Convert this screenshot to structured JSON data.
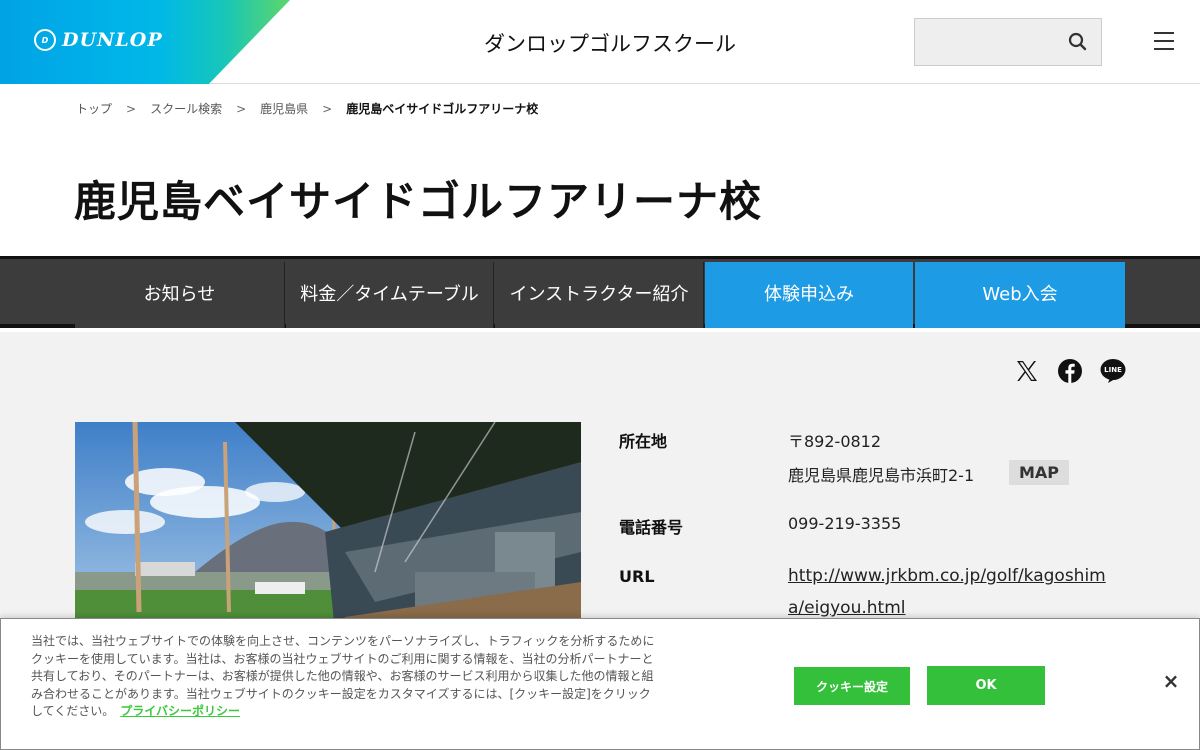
{
  "header": {
    "logo_text": "DUNLOP",
    "logo_mark": "D",
    "site_title": "ダンロップゴルフスクール",
    "search_placeholder": "",
    "search_icon": "search-icon",
    "menu_icon": "hamburger-menu-icon"
  },
  "breadcrumb": {
    "items": [
      "トップ",
      "スクール検索",
      "鹿児島県",
      "鹿児島ベイサイドゴルフアリーナ校"
    ],
    "separator": ">"
  },
  "page_title": "鹿児島ベイサイドゴルフアリーナ校",
  "nav": {
    "items": [
      {
        "label": "お知らせ"
      },
      {
        "label": "料金／タイムテーブル"
      },
      {
        "label": "インストラクター紹介"
      },
      {
        "label": "体験申込み"
      },
      {
        "label": "Web入会"
      }
    ],
    "accent_color": "#1d9be4"
  },
  "share": {
    "x_icon": "x-twitter-icon",
    "facebook_icon": "facebook-icon",
    "line_icon": "line-icon",
    "line_text": "LINE"
  },
  "info": {
    "address_label": "所在地",
    "postal": "〒892-0812",
    "address": "鹿児島県鹿児島市浜町2-1",
    "map_label": "MAP",
    "phone_label": "電話番号",
    "phone": "099-219-3355",
    "url_label": "URL",
    "url": "http://www.jrkbm.co.jp/golf/kagoshima/eigyou.html"
  },
  "cookie": {
    "text": "当社では、当社ウェブサイトでの体験を向上させ、コンテンツをパーソナライズし、トラフィックを分析するためにクッキーを使用しています。当社は、お客様の当社ウェブサイトのご利用に関する情報を、当社の分析パートナーと共有しており、そのパートナーは、お客様が提供した他の情報や、お客様のサービス利用から収集した他の情報と組み合わせることがあります。当社ウェブサイトのクッキー設定をカスタマイズするには、[クッキー設定]をクリックしてください。",
    "privacy_link": "プライバシーポリシー",
    "settings_button": "クッキー設定",
    "ok_button": "OK",
    "close_label": "×",
    "button_color": "#34c03a"
  }
}
